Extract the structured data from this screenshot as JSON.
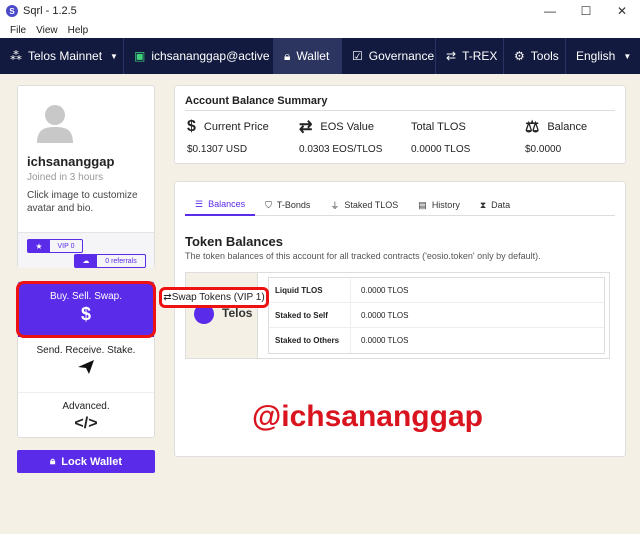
{
  "window": {
    "title": "Sqrl - 1.2.5",
    "controls": {
      "minimize": "—",
      "maximize": "☐",
      "close": "✕"
    }
  },
  "menu": [
    "File",
    "View",
    "Help"
  ],
  "nav": {
    "network": "Telos Mainnet",
    "account": "ichsananggap@active",
    "wallet": "Wallet",
    "governance": "Governance",
    "trex": "T-REX",
    "tools": "Tools",
    "language": "English"
  },
  "profile": {
    "username": "ichsananggap",
    "joined": "Joined in 3 hours",
    "hint": "Click image to customize avatar and bio.",
    "vip_label": "VIP 0",
    "referrals_label": "0 referrals"
  },
  "actions": {
    "buy": "Buy. Sell. Swap.",
    "buy_icon": "$",
    "send": "Send. Receive. Stake.",
    "advanced": "Advanced.",
    "advanced_icon": "</>",
    "lock": "Lock Wallet"
  },
  "summary": {
    "title": "Account Balance Summary",
    "current_price_label": "Current Price",
    "current_price_value": "$0.1307 USD",
    "eos_value_label": "EOS Value",
    "eos_value_value": "0.0303 EOS/TLOS",
    "total_tlos_label": "Total TLOS",
    "total_tlos_value": "0.0000 TLOS",
    "balance_label": "Balance",
    "balance_value": "$0.0000"
  },
  "tabs": [
    {
      "label": "Balances",
      "icon": "list-icon"
    },
    {
      "label": "T-Bonds",
      "icon": "shield-icon"
    },
    {
      "label": "Staked TLOS",
      "icon": "plug-icon"
    },
    {
      "label": "History",
      "icon": "book-icon"
    },
    {
      "label": "Data",
      "icon": "hourglass-icon"
    }
  ],
  "token_balances": {
    "title": "Token Balances",
    "subtitle": "The token balances of this account for all tracked contracts ('eosio.token' only by default).",
    "token_name": "Telos",
    "rows": [
      {
        "label": "Liquid TLOS",
        "value": "0.0000 TLOS"
      },
      {
        "label": "Staked to Self",
        "value": "0.0000 TLOS"
      },
      {
        "label": "Staked to Others",
        "value": "0.0000 TLOS"
      }
    ]
  },
  "swap_popup": "Swap Tokens (VIP 1)",
  "watermark": "@ichsananggap",
  "colors": {
    "accent": "#5a2be8",
    "navbar": "#121a3f",
    "highlight": "#e11111"
  }
}
